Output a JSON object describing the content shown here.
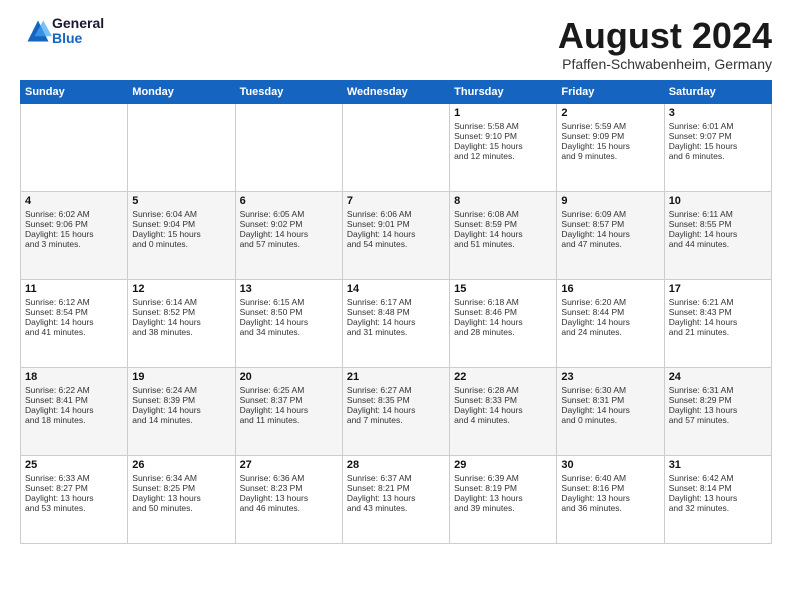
{
  "logo": {
    "general": "General",
    "blue": "Blue"
  },
  "title": "August 2024",
  "location": "Pfaffen-Schwabenheim, Germany",
  "headers": [
    "Sunday",
    "Monday",
    "Tuesday",
    "Wednesday",
    "Thursday",
    "Friday",
    "Saturday"
  ],
  "weeks": [
    [
      {
        "day": "",
        "info": ""
      },
      {
        "day": "",
        "info": ""
      },
      {
        "day": "",
        "info": ""
      },
      {
        "day": "",
        "info": ""
      },
      {
        "day": "1",
        "info": "Sunrise: 5:58 AM\nSunset: 9:10 PM\nDaylight: 15 hours\nand 12 minutes."
      },
      {
        "day": "2",
        "info": "Sunrise: 5:59 AM\nSunset: 9:09 PM\nDaylight: 15 hours\nand 9 minutes."
      },
      {
        "day": "3",
        "info": "Sunrise: 6:01 AM\nSunset: 9:07 PM\nDaylight: 15 hours\nand 6 minutes."
      }
    ],
    [
      {
        "day": "4",
        "info": "Sunrise: 6:02 AM\nSunset: 9:06 PM\nDaylight: 15 hours\nand 3 minutes."
      },
      {
        "day": "5",
        "info": "Sunrise: 6:04 AM\nSunset: 9:04 PM\nDaylight: 15 hours\nand 0 minutes."
      },
      {
        "day": "6",
        "info": "Sunrise: 6:05 AM\nSunset: 9:02 PM\nDaylight: 14 hours\nand 57 minutes."
      },
      {
        "day": "7",
        "info": "Sunrise: 6:06 AM\nSunset: 9:01 PM\nDaylight: 14 hours\nand 54 minutes."
      },
      {
        "day": "8",
        "info": "Sunrise: 6:08 AM\nSunset: 8:59 PM\nDaylight: 14 hours\nand 51 minutes."
      },
      {
        "day": "9",
        "info": "Sunrise: 6:09 AM\nSunset: 8:57 PM\nDaylight: 14 hours\nand 47 minutes."
      },
      {
        "day": "10",
        "info": "Sunrise: 6:11 AM\nSunset: 8:55 PM\nDaylight: 14 hours\nand 44 minutes."
      }
    ],
    [
      {
        "day": "11",
        "info": "Sunrise: 6:12 AM\nSunset: 8:54 PM\nDaylight: 14 hours\nand 41 minutes."
      },
      {
        "day": "12",
        "info": "Sunrise: 6:14 AM\nSunset: 8:52 PM\nDaylight: 14 hours\nand 38 minutes."
      },
      {
        "day": "13",
        "info": "Sunrise: 6:15 AM\nSunset: 8:50 PM\nDaylight: 14 hours\nand 34 minutes."
      },
      {
        "day": "14",
        "info": "Sunrise: 6:17 AM\nSunset: 8:48 PM\nDaylight: 14 hours\nand 31 minutes."
      },
      {
        "day": "15",
        "info": "Sunrise: 6:18 AM\nSunset: 8:46 PM\nDaylight: 14 hours\nand 28 minutes."
      },
      {
        "day": "16",
        "info": "Sunrise: 6:20 AM\nSunset: 8:44 PM\nDaylight: 14 hours\nand 24 minutes."
      },
      {
        "day": "17",
        "info": "Sunrise: 6:21 AM\nSunset: 8:43 PM\nDaylight: 14 hours\nand 21 minutes."
      }
    ],
    [
      {
        "day": "18",
        "info": "Sunrise: 6:22 AM\nSunset: 8:41 PM\nDaylight: 14 hours\nand 18 minutes."
      },
      {
        "day": "19",
        "info": "Sunrise: 6:24 AM\nSunset: 8:39 PM\nDaylight: 14 hours\nand 14 minutes."
      },
      {
        "day": "20",
        "info": "Sunrise: 6:25 AM\nSunset: 8:37 PM\nDaylight: 14 hours\nand 11 minutes."
      },
      {
        "day": "21",
        "info": "Sunrise: 6:27 AM\nSunset: 8:35 PM\nDaylight: 14 hours\nand 7 minutes."
      },
      {
        "day": "22",
        "info": "Sunrise: 6:28 AM\nSunset: 8:33 PM\nDaylight: 14 hours\nand 4 minutes."
      },
      {
        "day": "23",
        "info": "Sunrise: 6:30 AM\nSunset: 8:31 PM\nDaylight: 14 hours\nand 0 minutes."
      },
      {
        "day": "24",
        "info": "Sunrise: 6:31 AM\nSunset: 8:29 PM\nDaylight: 13 hours\nand 57 minutes."
      }
    ],
    [
      {
        "day": "25",
        "info": "Sunrise: 6:33 AM\nSunset: 8:27 PM\nDaylight: 13 hours\nand 53 minutes."
      },
      {
        "day": "26",
        "info": "Sunrise: 6:34 AM\nSunset: 8:25 PM\nDaylight: 13 hours\nand 50 minutes."
      },
      {
        "day": "27",
        "info": "Sunrise: 6:36 AM\nSunset: 8:23 PM\nDaylight: 13 hours\nand 46 minutes."
      },
      {
        "day": "28",
        "info": "Sunrise: 6:37 AM\nSunset: 8:21 PM\nDaylight: 13 hours\nand 43 minutes."
      },
      {
        "day": "29",
        "info": "Sunrise: 6:39 AM\nSunset: 8:19 PM\nDaylight: 13 hours\nand 39 minutes."
      },
      {
        "day": "30",
        "info": "Sunrise: 6:40 AM\nSunset: 8:16 PM\nDaylight: 13 hours\nand 36 minutes."
      },
      {
        "day": "31",
        "info": "Sunrise: 6:42 AM\nSunset: 8:14 PM\nDaylight: 13 hours\nand 32 minutes."
      }
    ]
  ]
}
